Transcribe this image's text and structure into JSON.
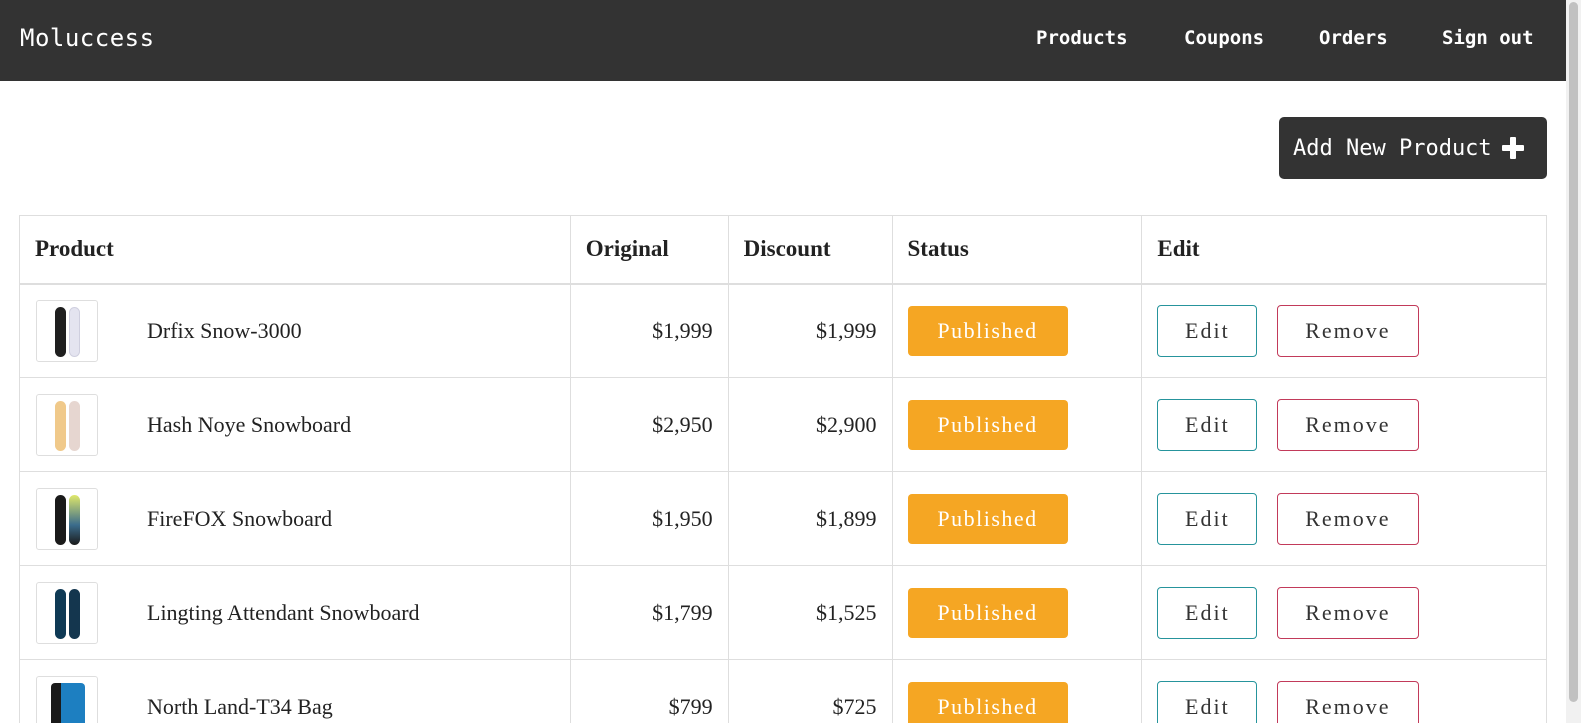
{
  "brand": "Moluccess",
  "nav": {
    "products": "Products",
    "coupons": "Coupons",
    "orders": "Orders",
    "signout": "Sign out"
  },
  "add_button": {
    "label": "Add New Product",
    "icon": "plus-icon"
  },
  "table": {
    "headers": [
      "Product",
      "Original",
      "Discount",
      "Status",
      "Edit"
    ],
    "edit_label": "Edit",
    "remove_label": "Remove",
    "rows": [
      {
        "name": "Drfix Snow-3000",
        "original": "$1,999",
        "discount": "$1,999",
        "status": "Published",
        "thumb_colors": [
          "#1f1f1f",
          "#e8e8f2"
        ]
      },
      {
        "name": "Hash Noye Snowboard",
        "original": "$2,950",
        "discount": "$2,900",
        "status": "Published",
        "thumb_colors": [
          "#f0c98a",
          "#e6d6d0"
        ]
      },
      {
        "name": "FireFOX Snowboard",
        "original": "$1,950",
        "discount": "$1,899",
        "status": "Published",
        "thumb_colors": [
          "#1a1a1a",
          "#3b6c8c"
        ]
      },
      {
        "name": "Lingting Attendant Snowboard",
        "original": "$1,799",
        "discount": "$1,525",
        "status": "Published",
        "thumb_colors": [
          "#0f3a55",
          "#14364e"
        ]
      },
      {
        "name": "North Land-T34 Bag",
        "original": "$799",
        "discount": "$725",
        "status": "Published",
        "thumb_colors": [
          "#1d7fc1",
          "#1a1a1a"
        ]
      }
    ]
  },
  "colors": {
    "navbar": "#333333",
    "status_badge": "#f5a623",
    "edit_border": "#26949c",
    "remove_border": "#c23a5a"
  }
}
